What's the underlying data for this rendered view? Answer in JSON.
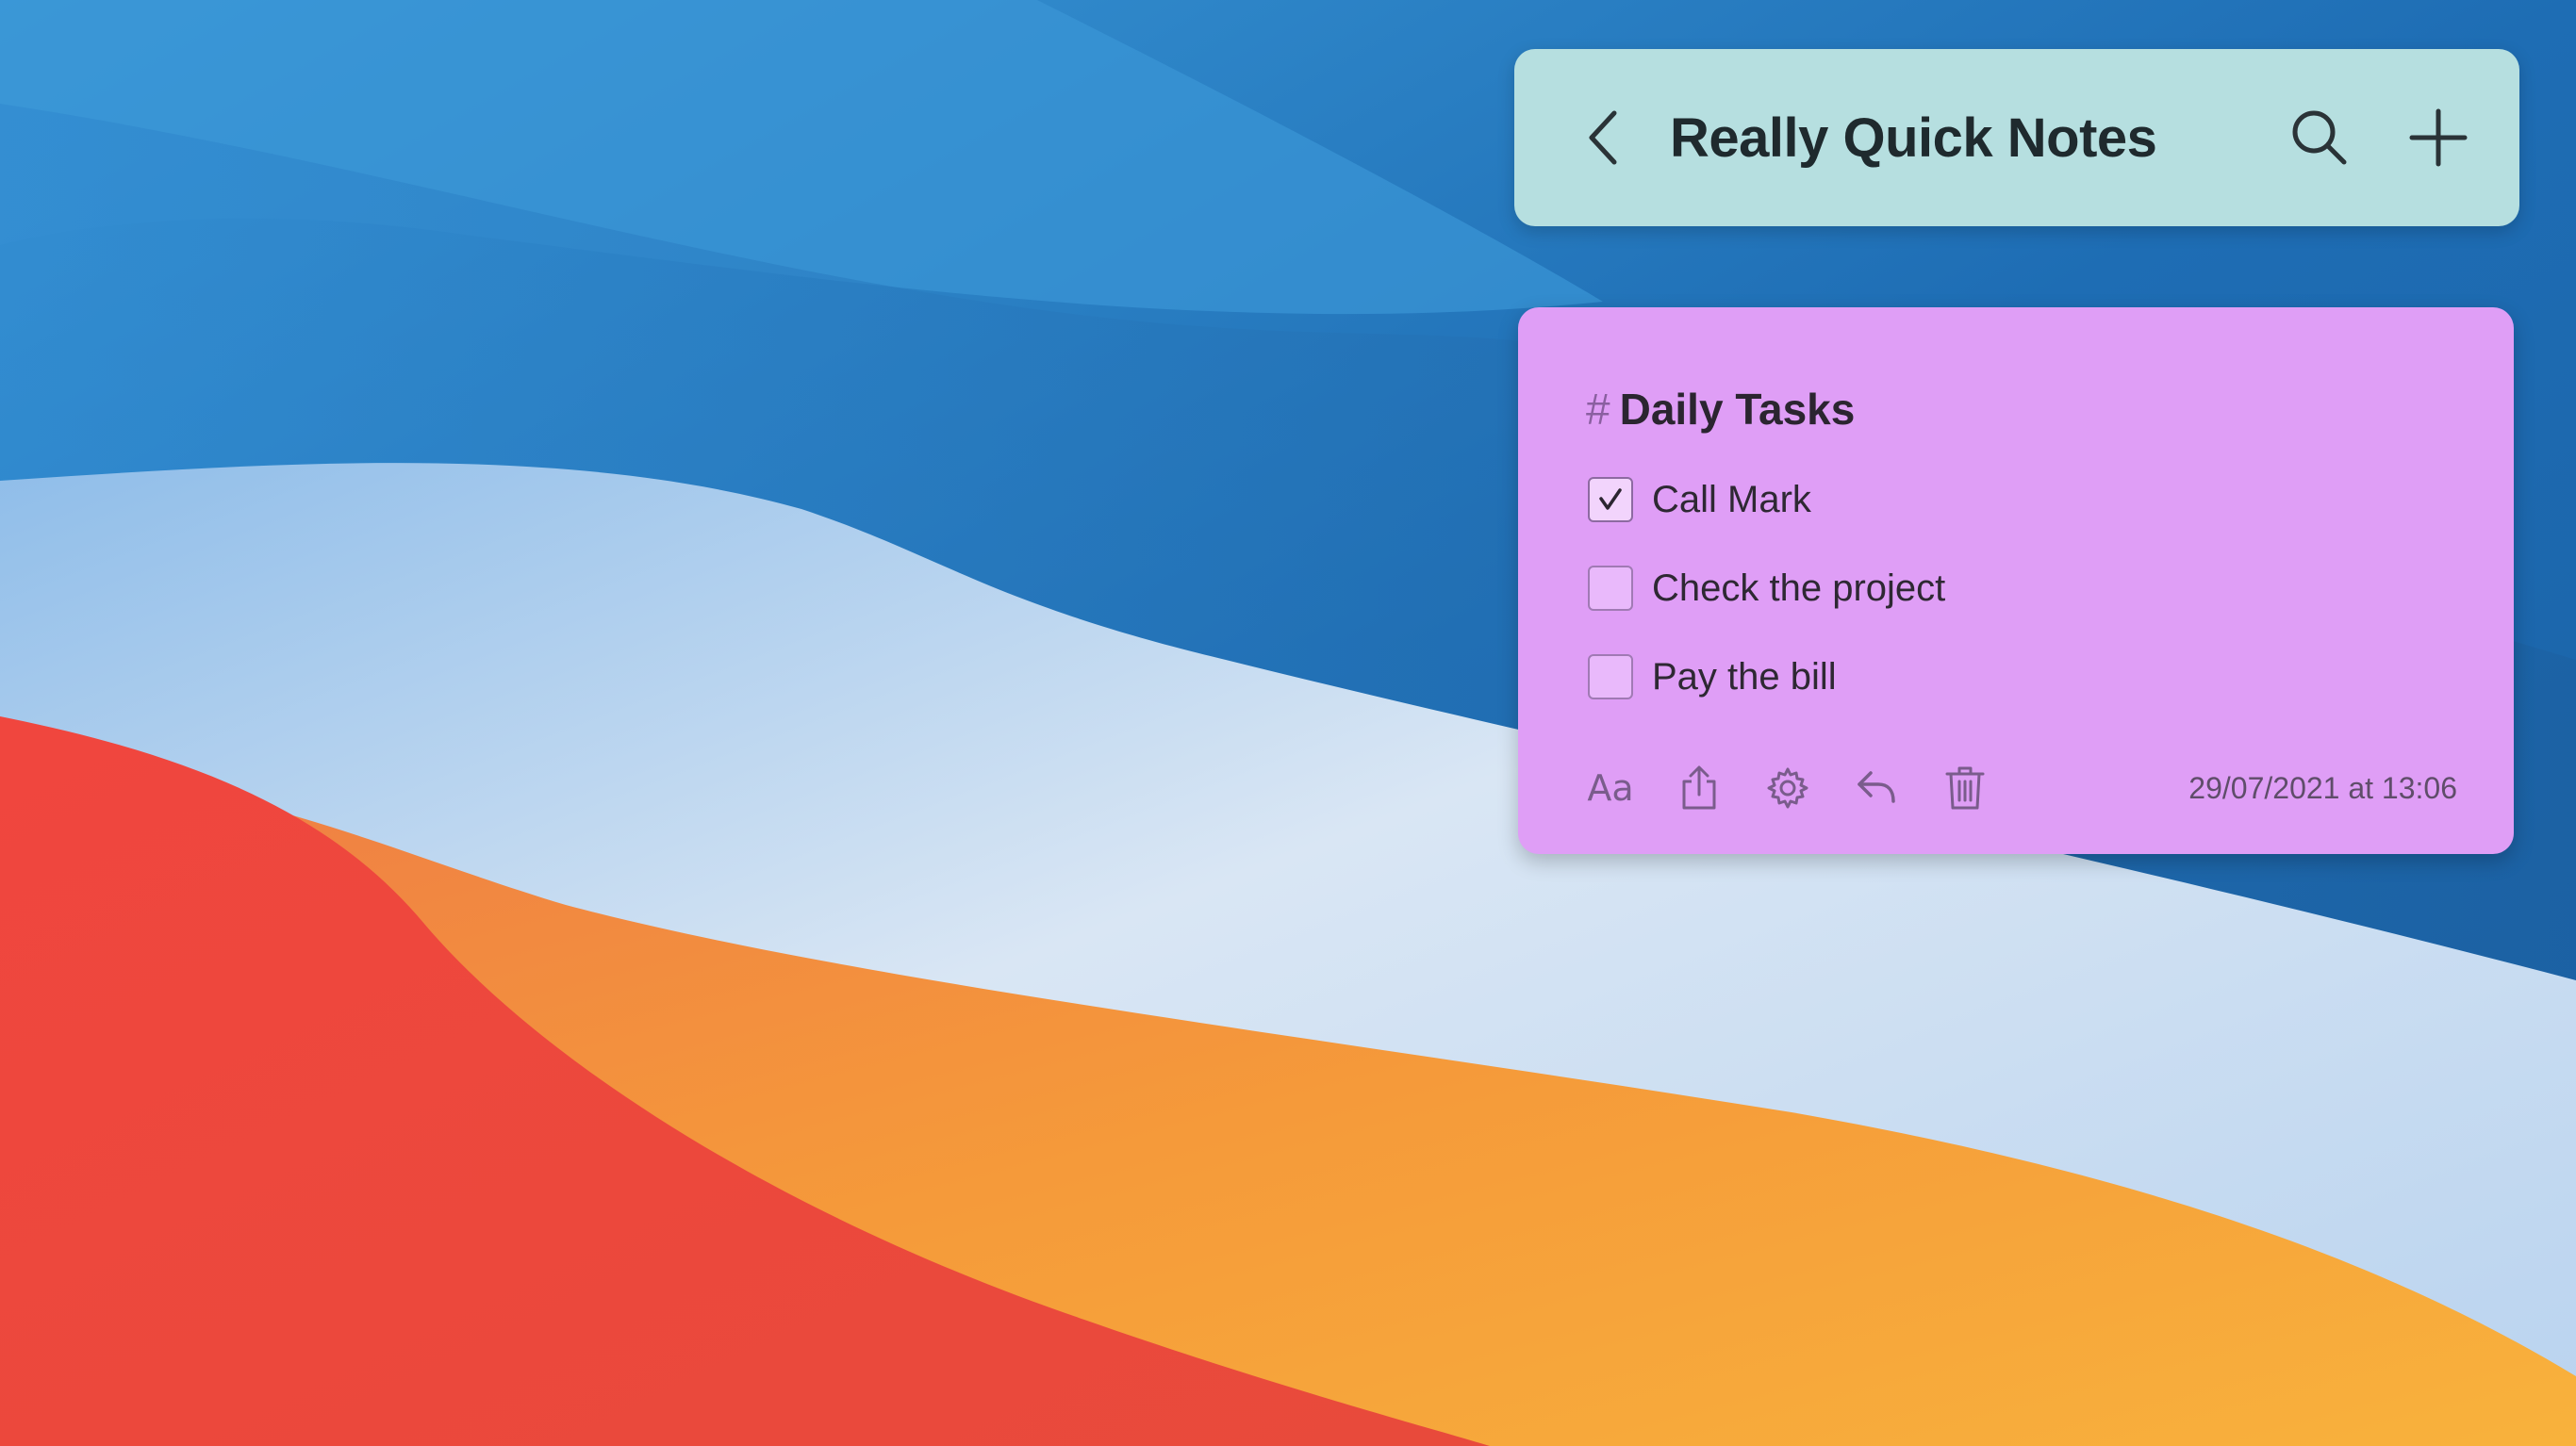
{
  "colors": {
    "header_bg": "#b6dfe0",
    "note_bg": "#df9ef6",
    "wallpaper_blue": "#1f6fb8",
    "wallpaper_red": "#ee4a3c",
    "wallpaper_orange": "#f49b3a"
  },
  "header": {
    "title": "Really Quick Notes",
    "back_icon": "chevron-left-icon",
    "search_icon": "search-icon",
    "add_icon": "plus-icon"
  },
  "note": {
    "hash": "#",
    "title": "Daily Tasks",
    "tasks": [
      {
        "label": "Call Mark",
        "checked": true
      },
      {
        "label": "Check the project",
        "checked": false
      },
      {
        "label": "Pay the bill",
        "checked": false
      }
    ],
    "toolbar": {
      "font_label": "Aa",
      "icons": [
        "font-icon",
        "share-icon",
        "gear-icon",
        "undo-icon",
        "trash-icon"
      ]
    },
    "timestamp": "29/07/2021 at 13:06"
  }
}
